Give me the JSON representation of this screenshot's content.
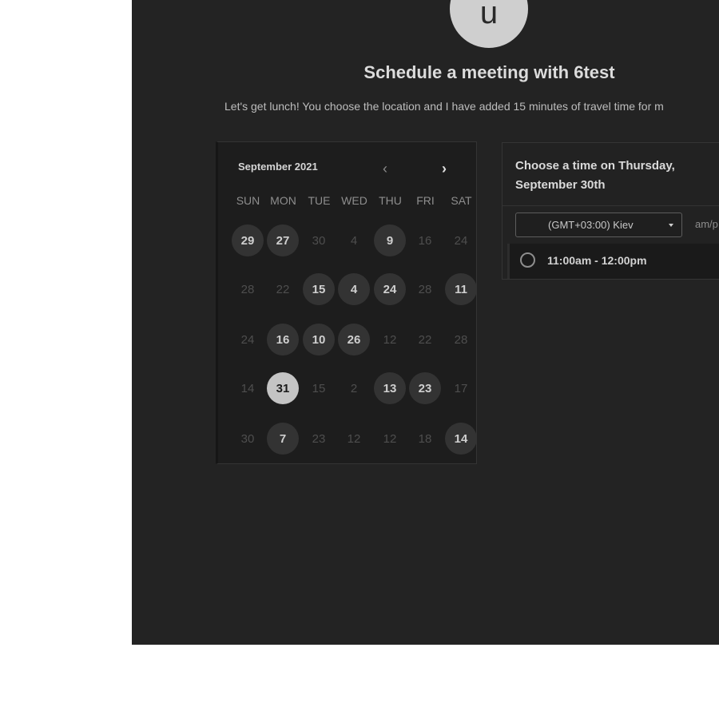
{
  "host": {
    "avatar_letter": "u",
    "title": "Schedule a meeting with 6test",
    "description": "Let's get lunch! You choose the location and I have added 15 minutes of travel time for m"
  },
  "calendar": {
    "month_label": "September 2021",
    "prev_icon": "chevron-left-icon",
    "next_icon": "chevron-right-icon",
    "weekdays": [
      "SUN",
      "MON",
      "TUE",
      "WED",
      "THU",
      "FRI",
      "SAT"
    ],
    "weeks": [
      [
        {
          "d": "29",
          "s": "available"
        },
        {
          "d": "27",
          "s": "available"
        },
        {
          "d": "30",
          "s": "muted"
        },
        {
          "d": "4",
          "s": "muted"
        },
        {
          "d": "9",
          "s": "available"
        },
        {
          "d": "16",
          "s": "muted"
        },
        {
          "d": "24",
          "s": "muted"
        }
      ],
      [
        {
          "d": "28",
          "s": "muted"
        },
        {
          "d": "22",
          "s": "muted"
        },
        {
          "d": "15",
          "s": "available"
        },
        {
          "d": "4",
          "s": "available"
        },
        {
          "d": "24",
          "s": "available"
        },
        {
          "d": "28",
          "s": "muted"
        },
        {
          "d": "11",
          "s": "available"
        }
      ],
      [
        {
          "d": "24",
          "s": "muted"
        },
        {
          "d": "16",
          "s": "available"
        },
        {
          "d": "10",
          "s": "available"
        },
        {
          "d": "26",
          "s": "available"
        },
        {
          "d": "12",
          "s": "muted"
        },
        {
          "d": "22",
          "s": "muted"
        },
        {
          "d": "28",
          "s": "muted"
        }
      ],
      [
        {
          "d": "14",
          "s": "muted"
        },
        {
          "d": "31",
          "s": "selected"
        },
        {
          "d": "15",
          "s": "muted"
        },
        {
          "d": "2",
          "s": "muted"
        },
        {
          "d": "13",
          "s": "available"
        },
        {
          "d": "23",
          "s": "available"
        },
        {
          "d": "17",
          "s": "muted"
        }
      ],
      [
        {
          "d": "30",
          "s": "muted"
        },
        {
          "d": "7",
          "s": "available"
        },
        {
          "d": "23",
          "s": "muted"
        },
        {
          "d": "12",
          "s": "muted"
        },
        {
          "d": "12",
          "s": "muted"
        },
        {
          "d": "18",
          "s": "muted"
        },
        {
          "d": "14",
          "s": "available"
        }
      ]
    ]
  },
  "timepicker": {
    "heading": "Choose a time on Thursday, September 30th",
    "timezone": "(GMT+03:00) Kiev",
    "format_toggle": "am/p",
    "slots": [
      "11:00am - 12:00pm"
    ]
  }
}
